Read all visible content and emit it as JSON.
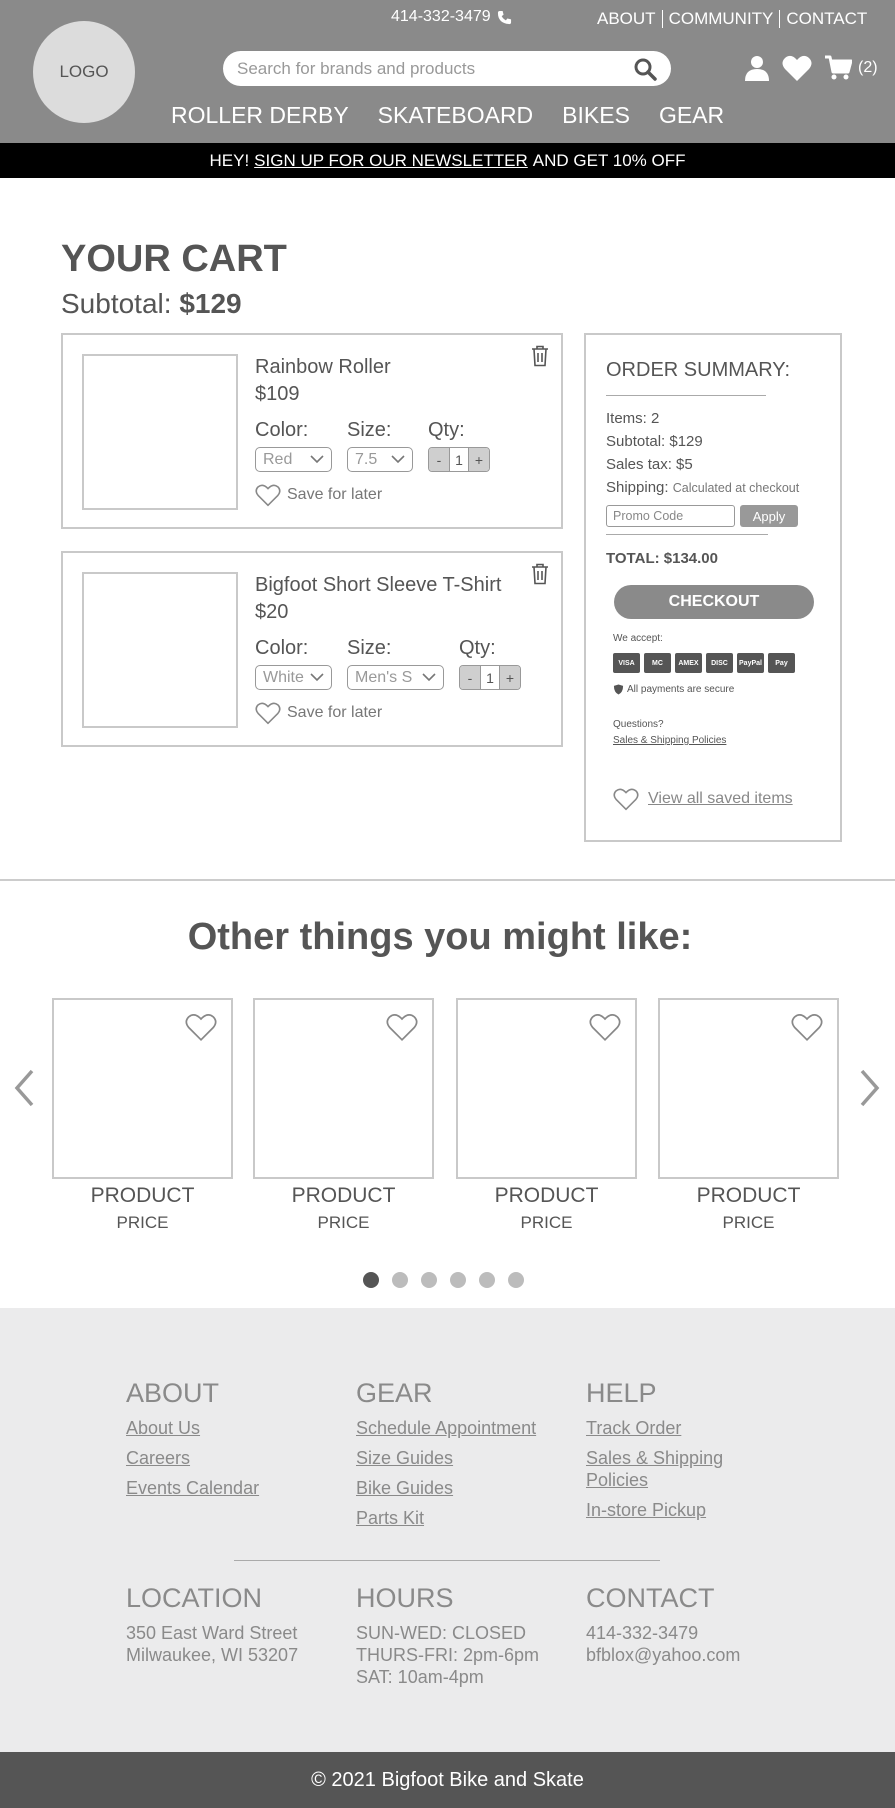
{
  "header": {
    "logo": "LOGO",
    "phone": "414-332-3479",
    "top_links": [
      "ABOUT",
      "COMMUNITY",
      "CONTACT"
    ],
    "search_placeholder": "Search for brands and products",
    "cart_count": "(2)",
    "nav": [
      "ROLLER DERBY",
      "SKATEBOARD",
      "BIKES",
      "GEAR"
    ]
  },
  "banner": {
    "prefix": "HEY!",
    "link": "SIGN UP FOR OUR NEWSLETTER",
    "suffix": "AND GET 10% OFF"
  },
  "cart": {
    "title": "YOUR CART",
    "subtotal_label": "Subtotal:",
    "subtotal_value": "$129",
    "labels": {
      "color": "Color:",
      "size": "Size:",
      "qty": "Qty:",
      "save": "Save for later",
      "minus": "-",
      "plus": "+"
    },
    "items": [
      {
        "name": "Rainbow Roller",
        "price": "$109",
        "color": "Red",
        "size": "7.5",
        "qty": "1"
      },
      {
        "name": "Bigfoot Short Sleeve T-Shirt",
        "price": "$20",
        "color": "White",
        "size": "Men's S",
        "qty": "1"
      }
    ]
  },
  "summary": {
    "title": "ORDER SUMMARY:",
    "items": "Items: 2",
    "subtotal": "Subtotal: $129",
    "tax": "Sales tax: $5",
    "shipping_label": "Shipping:",
    "shipping_note": "Calculated at checkout",
    "promo_placeholder": "Promo Code",
    "apply": "Apply",
    "total": "TOTAL: $134.00",
    "checkout": "CHECKOUT",
    "accept": "We accept:",
    "cards": [
      "VISA",
      "MC",
      "AMEX",
      "DISC",
      "PayPal",
      "Pay"
    ],
    "secure": "All payments are secure",
    "questions": "Questions?",
    "policies": "Sales & Shipping Policies",
    "view_saved": "View all saved items"
  },
  "recommendations": {
    "title": "Other things you might like:",
    "products": [
      {
        "name": "PRODUCT",
        "price": "PRICE"
      },
      {
        "name": "PRODUCT",
        "price": "PRICE"
      },
      {
        "name": "PRODUCT",
        "price": "PRICE"
      },
      {
        "name": "PRODUCT",
        "price": "PRICE"
      }
    ],
    "dots_total": 6,
    "active_dot": 1
  },
  "footer": {
    "about": {
      "title": "ABOUT",
      "links": [
        "About Us",
        "Careers",
        "Events Calendar"
      ]
    },
    "gear": {
      "title": "GEAR",
      "links": [
        "Schedule Appointment",
        "Size Guides",
        "Bike Guides",
        "Parts Kit"
      ]
    },
    "help": {
      "title": "HELP",
      "links": [
        "Track Order",
        "Sales & Shipping Policies",
        "In-store Pickup"
      ]
    },
    "location": {
      "title": "LOCATION",
      "line1": "350 East Ward Street",
      "line2": "Milwaukee, WI 53207"
    },
    "hours": {
      "title": "HOURS",
      "line1": "SUN-WED: CLOSED",
      "line2": "THURS-FRI: 2pm-6pm",
      "line3": "SAT: 10am-4pm"
    },
    "contact": {
      "title": "CONTACT",
      "phone": "414-332-3479",
      "email": "bfblox@yahoo.com"
    },
    "copyright": "© 2021 Bigfoot Bike and Skate"
  }
}
